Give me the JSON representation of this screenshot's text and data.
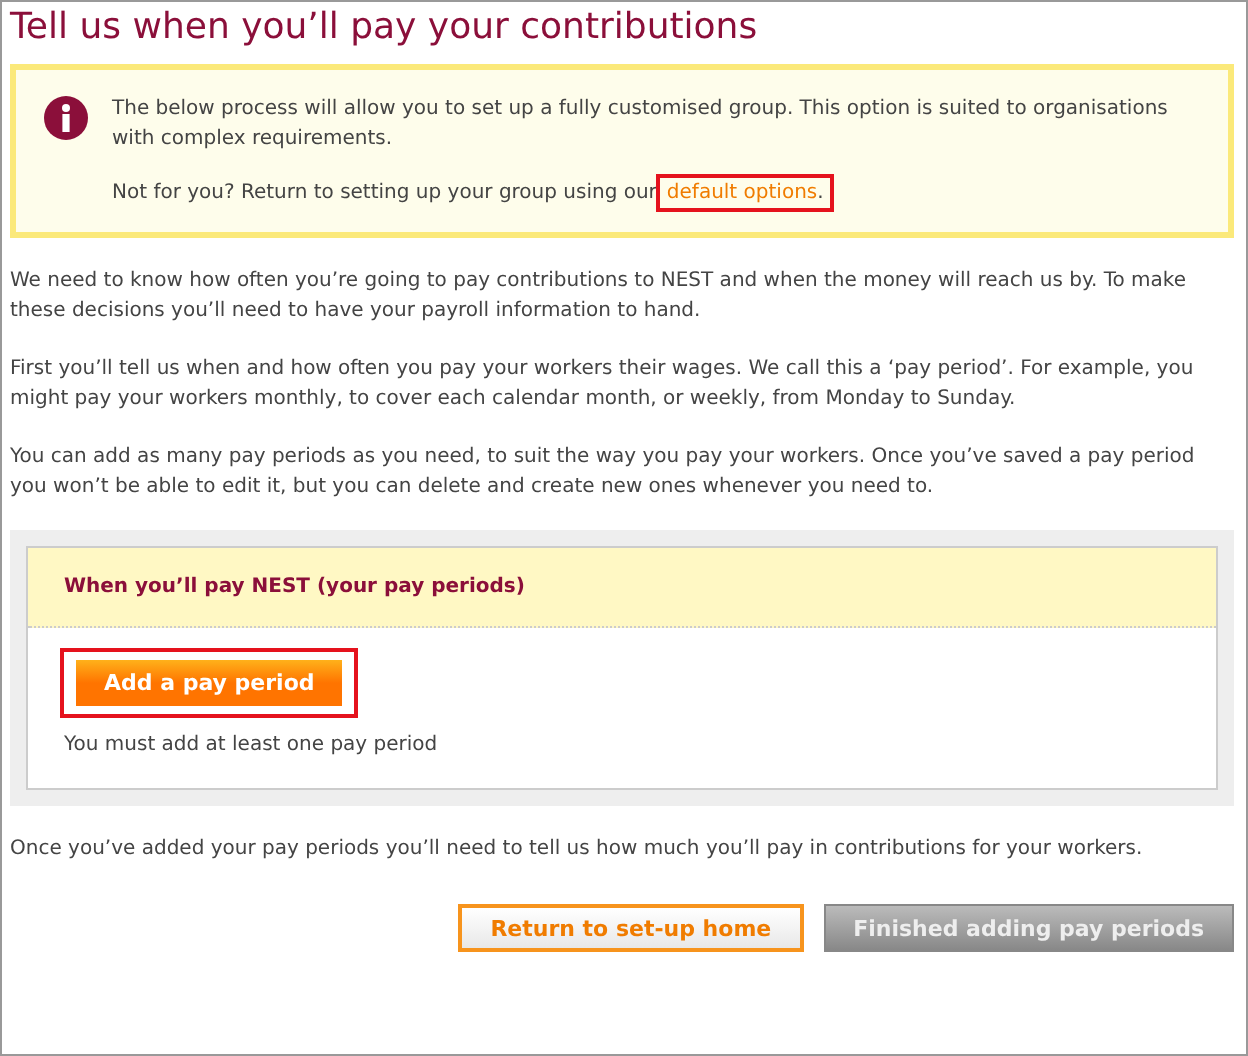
{
  "title": "Tell us when you’ll pay your contributions",
  "notice": {
    "text": "The below process will allow you to set up a fully customised group. This option is suited to organisations with complex requirements.",
    "prompt": "Not for you? Return to setting up your group using our",
    "link": {
      "label": "default options",
      "highlighted": true
    },
    "after_link": "."
  },
  "paragraphs": [
    "We need to know how often you’re going to pay contributions to NEST and when the money will reach us by. To make these decisions you’ll need to have your payroll information to hand.",
    "First you’ll tell us when and how often you pay your workers their wages. We call this a ‘pay period’. For example, you might pay your workers monthly, to cover each calendar month, or weekly, from Monday to Sunday.",
    "You can add as many pay periods as you need, to suit the way you pay your workers. Once you’ve saved a pay period you won’t be able to edit it, but you can delete and create new ones whenever you need to."
  ],
  "panel": {
    "heading": "When you’ll pay NEST (your pay periods)",
    "button": {
      "label": "Add a pay period",
      "highlighted": true
    },
    "hint": "You must add at least one pay period"
  },
  "footer_text": "Once you’ve added your pay periods you’ll need to tell us how much you’ll pay in contributions for your workers.",
  "buttons": [
    {
      "label": "Return to set-up home",
      "disabled": false
    },
    {
      "label": "Finished adding pay periods",
      "disabled": true
    }
  ]
}
